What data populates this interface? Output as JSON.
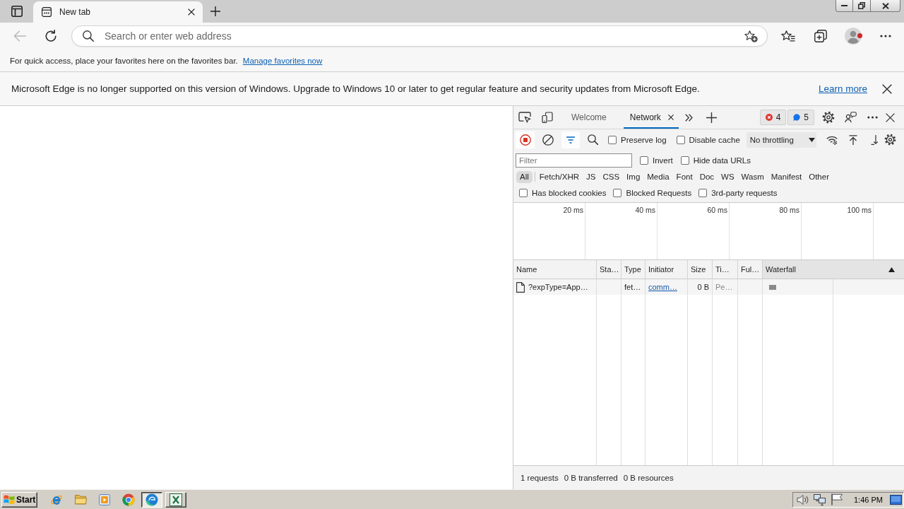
{
  "browser": {
    "tabs": [
      {
        "title": "New tab",
        "selected": true
      }
    ],
    "navigation": [
      {
        "kind": "back",
        "disabled": true
      },
      {
        "kind": "refresh",
        "disabled": false
      }
    ],
    "address_bar": {
      "placeholder": "Search or enter web address"
    },
    "favorites_bar": {
      "text": "For quick access, place your favorites here on the favorites bar.",
      "link": "Manage favorites now"
    },
    "notification": {
      "message": "Microsoft Edge is no longer supported on this version of Windows. Upgrade to Windows 10 or later to get regular feature and security updates from Microsoft Edge.",
      "link": "Learn more"
    }
  },
  "devtools": {
    "tabs": [
      {
        "label": "Welcome",
        "selected": false,
        "closable": false
      },
      {
        "label": "Network",
        "selected": true,
        "closable": true
      }
    ],
    "issues": [
      {
        "kind": "error",
        "count": "4"
      },
      {
        "kind": "info",
        "count": "5"
      }
    ],
    "toolbar": {
      "recording": true,
      "filter_open": true,
      "options": [
        {
          "label": "Preserve log",
          "checked": false
        },
        {
          "label": "Disable cache",
          "checked": false
        }
      ],
      "throttling": "No throttling"
    },
    "filter": {
      "placeholder": "Filter",
      "options": [
        {
          "label": "Invert",
          "checked": false
        },
        {
          "label": "Hide data URLs",
          "checked": false
        }
      ]
    },
    "resource_types": [
      {
        "label": "All",
        "selected": true
      },
      {
        "label": "Fetch/XHR",
        "selected": false
      },
      {
        "label": "JS",
        "selected": false
      },
      {
        "label": "CSS",
        "selected": false
      },
      {
        "label": "Img",
        "selected": false
      },
      {
        "label": "Media",
        "selected": false
      },
      {
        "label": "Font",
        "selected": false
      },
      {
        "label": "Doc",
        "selected": false
      },
      {
        "label": "WS",
        "selected": false
      },
      {
        "label": "Wasm",
        "selected": false
      },
      {
        "label": "Manifest",
        "selected": false
      },
      {
        "label": "Other",
        "selected": false
      }
    ],
    "request_filters": [
      {
        "label": "Has blocked cookies",
        "checked": false
      },
      {
        "label": "Blocked Requests",
        "checked": false
      },
      {
        "label": "3rd-party requests",
        "checked": false
      }
    ],
    "overview": {
      "ticks": [
        "20 ms",
        "40 ms",
        "60 ms",
        "80 ms",
        "100 ms"
      ]
    },
    "table": {
      "columns": [
        {
          "label": "Name",
          "sorted": false
        },
        {
          "label": "Sta…",
          "sorted": false
        },
        {
          "label": "Type",
          "sorted": false
        },
        {
          "label": "Initiator",
          "sorted": false
        },
        {
          "label": "Size",
          "sorted": false
        },
        {
          "label": "Ti…",
          "sorted": false
        },
        {
          "label": "Ful…",
          "sorted": false
        },
        {
          "label": "Waterfall",
          "sorted": true
        }
      ],
      "rows": [
        {
          "name": "?expType=App…",
          "type": "fet…",
          "initiator": "comm…",
          "size": "0 B",
          "time": "Pe…",
          "pending": true
        }
      ]
    },
    "summary": [
      "1 requests",
      "0 B transferred",
      "0 B resources"
    ]
  },
  "taskbar": {
    "start": "Start",
    "apps": [
      {
        "kind": "ie",
        "open": false,
        "selected": false
      },
      {
        "kind": "explorer",
        "open": false,
        "selected": false
      },
      {
        "kind": "media",
        "open": false,
        "selected": false
      },
      {
        "kind": "chrome",
        "open": false,
        "selected": false
      },
      {
        "kind": "edge",
        "open": true,
        "selected": true
      },
      {
        "kind": "excel",
        "open": true,
        "selected": false
      }
    ],
    "clock": "1:46 PM"
  }
}
